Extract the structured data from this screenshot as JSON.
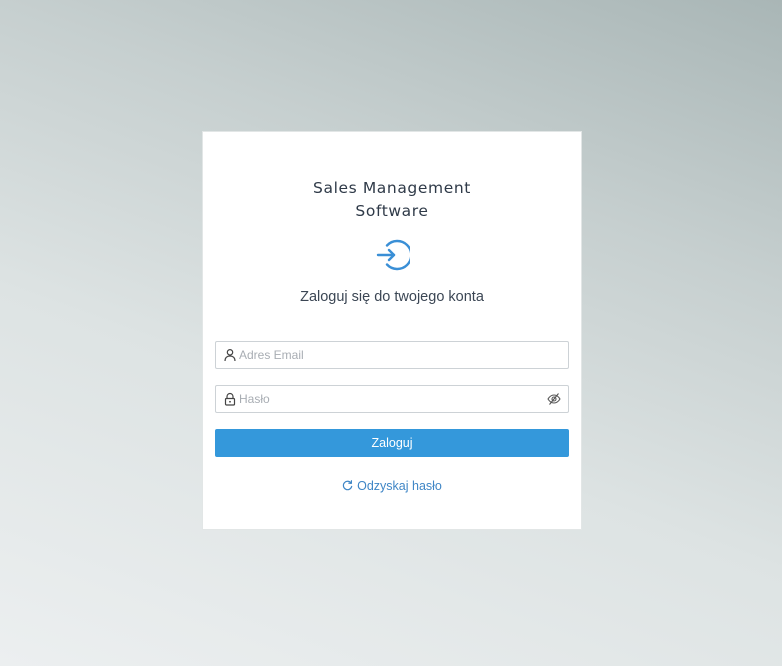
{
  "app": {
    "title_line1": "Sales Management",
    "title_line2": "Software"
  },
  "login": {
    "subtitle": "Zaloguj się do twojego konta",
    "email_placeholder": "Adres Email",
    "email_value": "",
    "password_placeholder": "Hasło",
    "password_value": "",
    "submit_label": "Zaloguj",
    "recover_label": "Odzyskaj hasło"
  },
  "icons": {
    "login": "sign-in-icon",
    "email": "user-icon",
    "password": "lock-icon",
    "toggle_password": "eye-slash-icon",
    "recover": "refresh-icon"
  },
  "colors": {
    "accent": "#3498db",
    "link": "#3f86c6",
    "icon_blue": "#3a8fd6",
    "text_dark": "#2f3a48"
  }
}
